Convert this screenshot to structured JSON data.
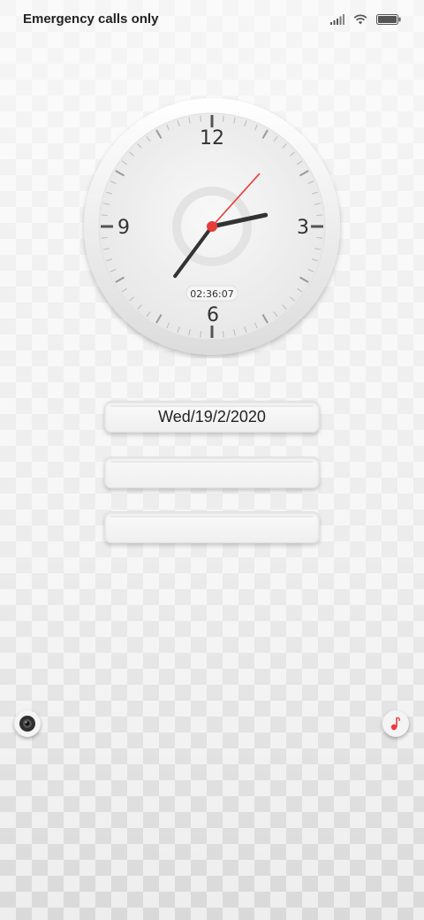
{
  "status_bar": {
    "carrier_text": "Emergency calls only",
    "icons": [
      "signal-icon",
      "wifi-icon",
      "battery-icon"
    ]
  },
  "clock": {
    "numerals": {
      "twelve": "12",
      "three": "3",
      "six": "6",
      "nine": "9"
    },
    "digital_time": "02:36:07",
    "hour": 2,
    "minute": 36,
    "second": 7,
    "colors": {
      "hands": "#333333",
      "second_hand": "#e83b3b",
      "face": "#f2f2f2"
    }
  },
  "info_boxes": [
    {
      "text": "Wed/19/2/2020"
    },
    {
      "text": ""
    },
    {
      "text": ""
    }
  ],
  "shortcuts": {
    "left": "camera-icon",
    "right": "music-note-icon",
    "accent_color": "#e83b3b"
  }
}
